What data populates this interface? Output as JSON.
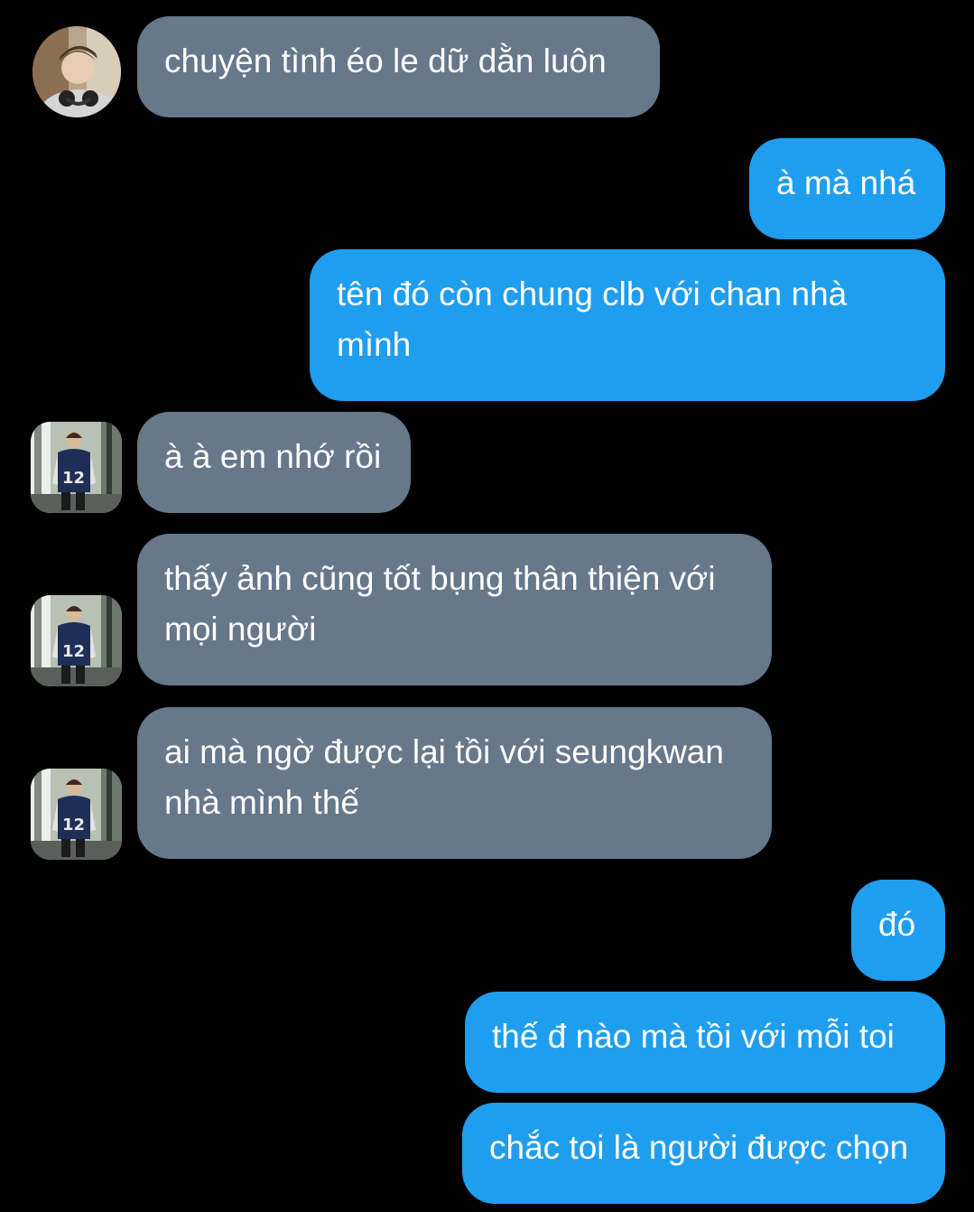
{
  "conversation": {
    "messages": [
      {
        "sender": "other",
        "text": "chuyện tình éo le dữ dằn luôn"
      },
      {
        "sender": "me",
        "text": "à mà nhá"
      },
      {
        "sender": "me",
        "text": "tên đó còn chung clb với chan nhà mình"
      },
      {
        "sender": "other",
        "text": "à à em nhớ rồi"
      },
      {
        "sender": "other",
        "text": "thấy ảnh cũng tốt bụng thân thiện với mọi người"
      },
      {
        "sender": "other",
        "text": "ai mà ngờ được lại tồi với seungkwan nhà mình thế"
      },
      {
        "sender": "me",
        "text": "đó"
      },
      {
        "sender": "me",
        "text": "thế đ nào mà tồi với mỗi toi"
      },
      {
        "sender": "me",
        "text": "chắc toi là người được chọn"
      }
    ]
  },
  "colors": {
    "background": "#000000",
    "incoming_bubble": "#66788a",
    "outgoing_bubble": "#1f9ef0",
    "text": "#ffffff"
  }
}
